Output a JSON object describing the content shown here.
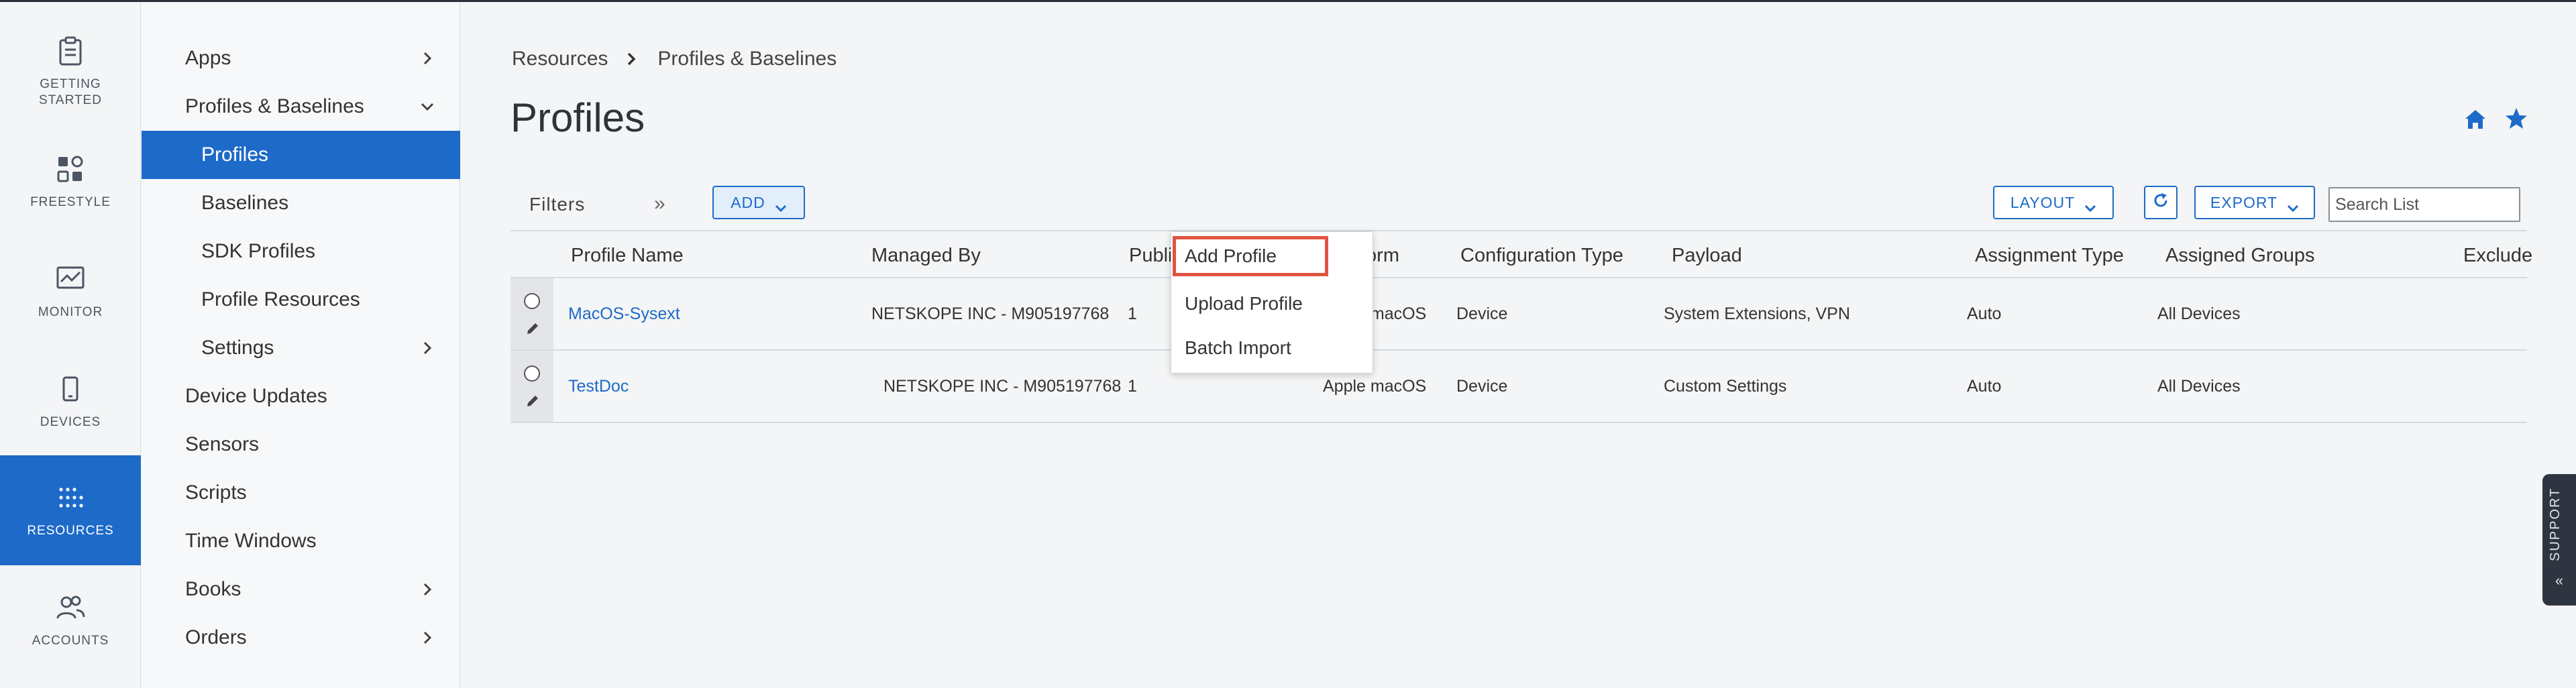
{
  "rail": {
    "items": [
      {
        "label_line1": "GETTING",
        "label_line2": "STARTED",
        "icon": "clipboard-icon",
        "active": false
      },
      {
        "label_line1": "FREESTYLE",
        "label_line2": "",
        "icon": "freestyle-icon",
        "active": false
      },
      {
        "label_line1": "MONITOR",
        "label_line2": "",
        "icon": "monitor-icon",
        "active": false
      },
      {
        "label_line1": "DEVICES",
        "label_line2": "",
        "icon": "phone-icon",
        "active": false
      },
      {
        "label_line1": "RESOURCES",
        "label_line2": "",
        "icon": "grid-dots-icon",
        "active": true
      },
      {
        "label_line1": "ACCOUNTS",
        "label_line2": "",
        "icon": "users-icon",
        "active": false
      }
    ]
  },
  "nav": {
    "items": [
      {
        "label": "Apps",
        "chevron": "right"
      },
      {
        "label": "Profiles & Baselines",
        "chevron": "down"
      },
      {
        "label": "Profiles",
        "selected": true
      },
      {
        "label": "Baselines"
      },
      {
        "label": "SDK Profiles"
      },
      {
        "label": "Profile Resources"
      },
      {
        "label": "Settings",
        "chevron": "right"
      },
      {
        "label": "Device Updates"
      },
      {
        "label": "Sensors"
      },
      {
        "label": "Scripts"
      },
      {
        "label": "Time Windows"
      },
      {
        "label": "Books",
        "chevron": "right"
      },
      {
        "label": "Orders",
        "chevron": "right"
      }
    ]
  },
  "breadcrumb": {
    "root": "Resources",
    "current": "Profiles & Baselines"
  },
  "page": {
    "title": "Profiles"
  },
  "toolbar": {
    "filters_label": "Filters",
    "filters_toggle": "»",
    "add_label": "ADD",
    "layout_label": "LAYOUT",
    "export_label": "EXPORT",
    "search_placeholder": "Search List"
  },
  "table": {
    "columns": [
      "Profile Name",
      "Managed By",
      "Published Version",
      "Platform",
      "Configuration Type",
      "Payload",
      "Assignment Type",
      "Assigned Groups",
      "Exclude"
    ],
    "rows": [
      {
        "profile_name": "MacOS-Sysext",
        "managed_by": "NETSKOPE INC - M905197768",
        "published_version": "1",
        "platform": "Apple macOS",
        "configuration_type": "Device",
        "payload": "System Extensions, VPN",
        "assignment_type": "Auto",
        "assigned_groups": "All Devices"
      },
      {
        "profile_name": "TestDoc",
        "managed_by": "NETSKOPE INC - M905197768",
        "published_version": "1",
        "platform": "Apple macOS",
        "configuration_type": "Device",
        "payload": "Custom Settings",
        "assignment_type": "Auto",
        "assigned_groups": "All Devices"
      }
    ]
  },
  "add_menu": {
    "items": [
      "Add Profile",
      "Upload Profile",
      "Batch Import"
    ],
    "highlight_color": "#e0533f"
  },
  "support": {
    "label": "SUPPORT"
  },
  "colors": {
    "accent": "#1d6ac9",
    "rail_bg": "#f4f5f6",
    "highlight": "#e0533f"
  }
}
